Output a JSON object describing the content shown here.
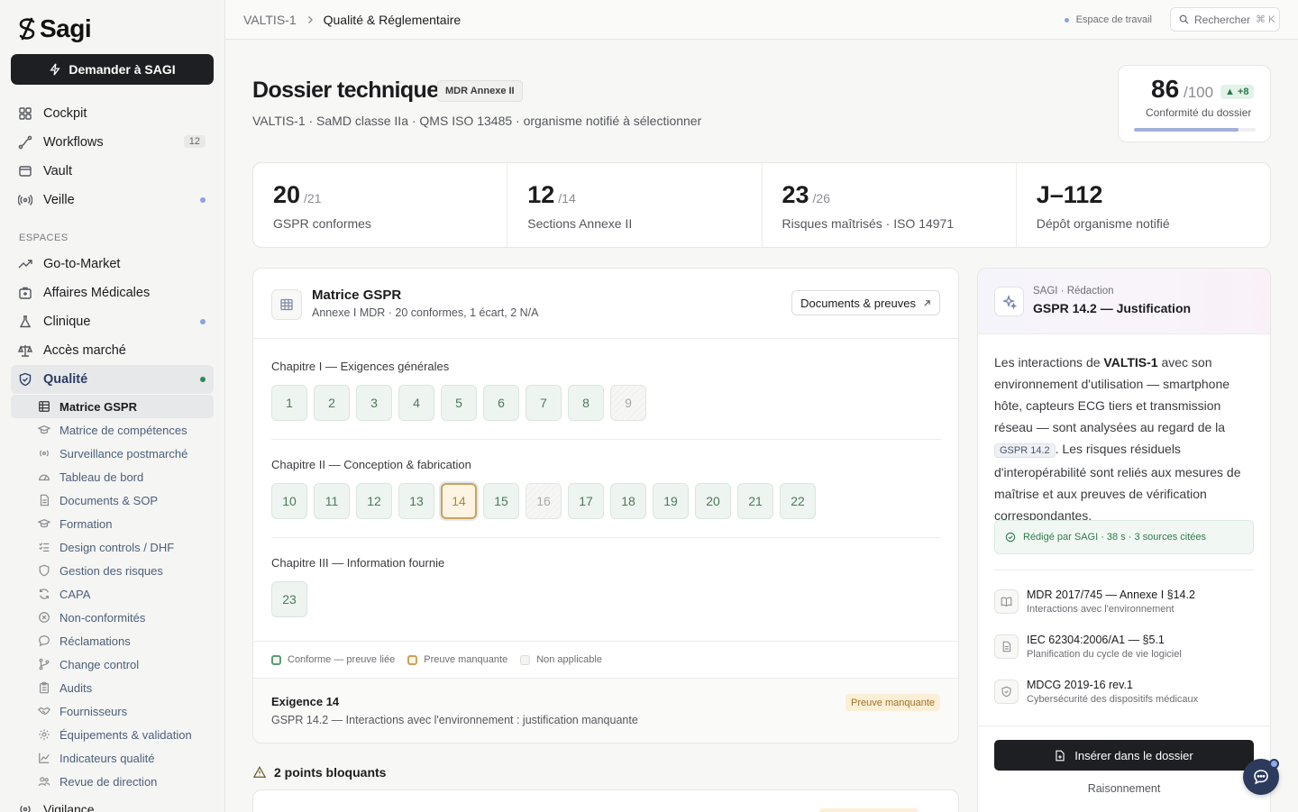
{
  "brand": {
    "name": "Sagi"
  },
  "ask_button": {
    "label": "Demander à SAGI"
  },
  "nav": [
    {
      "label": "Cockpit",
      "icon": "grid-icon"
    },
    {
      "label": "Workflows",
      "icon": "workflow-icon",
      "count": "12"
    },
    {
      "label": "Vault",
      "icon": "vault-icon"
    },
    {
      "label": "Veille",
      "icon": "radar-icon",
      "dot": true
    }
  ],
  "spaces_label": "ESPACES",
  "spaces": [
    {
      "label": "Go-to-Market",
      "icon": "trend-icon"
    },
    {
      "label": "Affaires Médicales",
      "icon": "medkit-icon"
    },
    {
      "label": "Clinique",
      "icon": "flask-icon",
      "dot": true
    },
    {
      "label": "Accès marché",
      "icon": "scale-icon"
    },
    {
      "label": "Qualité",
      "icon": "shield-check-icon",
      "dot": true,
      "active": true
    }
  ],
  "quality_subnav": [
    {
      "label": "Matrice GSPR",
      "active": true
    },
    {
      "label": "Matrice de compétences"
    },
    {
      "label": "Surveillance postmarché"
    },
    {
      "label": "Tableau de bord"
    },
    {
      "label": "Documents & SOP"
    },
    {
      "label": "Formation"
    },
    {
      "label": "Design controls / DHF"
    },
    {
      "label": "Gestion des risques"
    },
    {
      "label": "CAPA"
    },
    {
      "label": "Non-conformités"
    },
    {
      "label": "Réclamations"
    },
    {
      "label": "Change control"
    },
    {
      "label": "Audits"
    },
    {
      "label": "Fournisseurs"
    },
    {
      "label": "Équipements & validation"
    },
    {
      "label": "Indicateurs qualité"
    },
    {
      "label": "Revue de direction"
    }
  ],
  "nav_bottom": "Vigilance",
  "topbar": {
    "breadcrumb": [
      "VALTIS-1",
      "Qualité & Réglementaire"
    ],
    "workspace": "Espace de travail",
    "search_label": "Rechercher",
    "search_kbd": "⌘ K"
  },
  "header": {
    "title": "Dossier technique",
    "badge": "MDR Annexe II",
    "subtitle": "VALTIS-1 · SaMD classe IIa · QMS ISO 13485 · organisme notifié à sélectionner"
  },
  "score": {
    "value": "86",
    "max": "/100",
    "delta": "▲ +8",
    "label": "Conformité du dossier",
    "progress": 0.86
  },
  "kpis": [
    {
      "value": "20",
      "den": "/21",
      "label": "GSPR conformes"
    },
    {
      "value": "12",
      "den": "/14",
      "label": "Sections Annexe II"
    },
    {
      "value": "23",
      "den": "/26",
      "label": "Risques maîtrisés · ISO 14971"
    },
    {
      "value": "J–112",
      "den": "",
      "label": "Dépôt organisme notifié"
    }
  ],
  "matrix": {
    "title": "Matrice GSPR",
    "subtitle": "Annexe I MDR · 20 conformes, 1 écart, 2 N/A",
    "docs_button": "Documents & preuves",
    "chapters": [
      {
        "title": "Chapitre I — Exigences générales",
        "items": [
          {
            "n": "1",
            "s": "ok"
          },
          {
            "n": "2",
            "s": "ok"
          },
          {
            "n": "3",
            "s": "ok"
          },
          {
            "n": "4",
            "s": "ok"
          },
          {
            "n": "5",
            "s": "ok"
          },
          {
            "n": "6",
            "s": "ok"
          },
          {
            "n": "7",
            "s": "ok"
          },
          {
            "n": "8",
            "s": "ok"
          },
          {
            "n": "9",
            "s": "na"
          }
        ]
      },
      {
        "title": "Chapitre II — Conception & fabrication",
        "items": [
          {
            "n": "10",
            "s": "ok"
          },
          {
            "n": "11",
            "s": "ok"
          },
          {
            "n": "12",
            "s": "ok"
          },
          {
            "n": "13",
            "s": "ok"
          },
          {
            "n": "14",
            "s": "missing"
          },
          {
            "n": "15",
            "s": "ok"
          },
          {
            "n": "16",
            "s": "na"
          },
          {
            "n": "17",
            "s": "ok"
          },
          {
            "n": "18",
            "s": "ok"
          },
          {
            "n": "19",
            "s": "ok"
          },
          {
            "n": "20",
            "s": "ok"
          },
          {
            "n": "21",
            "s": "ok"
          },
          {
            "n": "22",
            "s": "ok"
          }
        ]
      },
      {
        "title": "Chapitre III — Information fournie",
        "items": [
          {
            "n": "23",
            "s": "ok"
          }
        ]
      }
    ],
    "legend": [
      "Conforme — preuve liée",
      "Preuve manquante",
      "Non applicable"
    ],
    "selected": {
      "title": "Exigence 14",
      "desc": "GSPR 14.2 — Interactions avec l'environnement : justification manquante",
      "status": "Preuve manquante"
    }
  },
  "blockers": {
    "label": "2 points bloquants"
  },
  "ai_panel": {
    "kicker": "SAGI · Rédaction",
    "title": "GSPR 14.2 — Justification",
    "body_1": "Les interactions de ",
    "body_strong": "VALTIS-1",
    "body_2": " avec son environnement d'utilisation — smartphone hôte, capteurs ECG tiers et transmission réseau — sont analysées au regard de la ",
    "body_code": "GSPR 14.2",
    "body_3": ". Les risques résiduels d'interopérabilité sont reliés aux mesures de maîtrise et aux preuves de vérification correspondantes.",
    "done": "Rédigé par SAGI · 38 s · 3 sources citées",
    "sources": [
      {
        "title": "MDR 2017/745 — Annexe I §14.2",
        "sub": "Interactions avec l'environnement",
        "icon": "book-icon"
      },
      {
        "title": "IEC 62304:2006/A1 — §5.1",
        "sub": "Planification du cycle de vie logiciel",
        "icon": "document-icon"
      },
      {
        "title": "MDCG 2019-16 rev.1",
        "sub": "Cybersécurité des dispositifs médicaux",
        "icon": "shield-icon"
      }
    ],
    "insert_button": "Insérer dans le dossier",
    "reasoning_link": "Raisonnement"
  }
}
